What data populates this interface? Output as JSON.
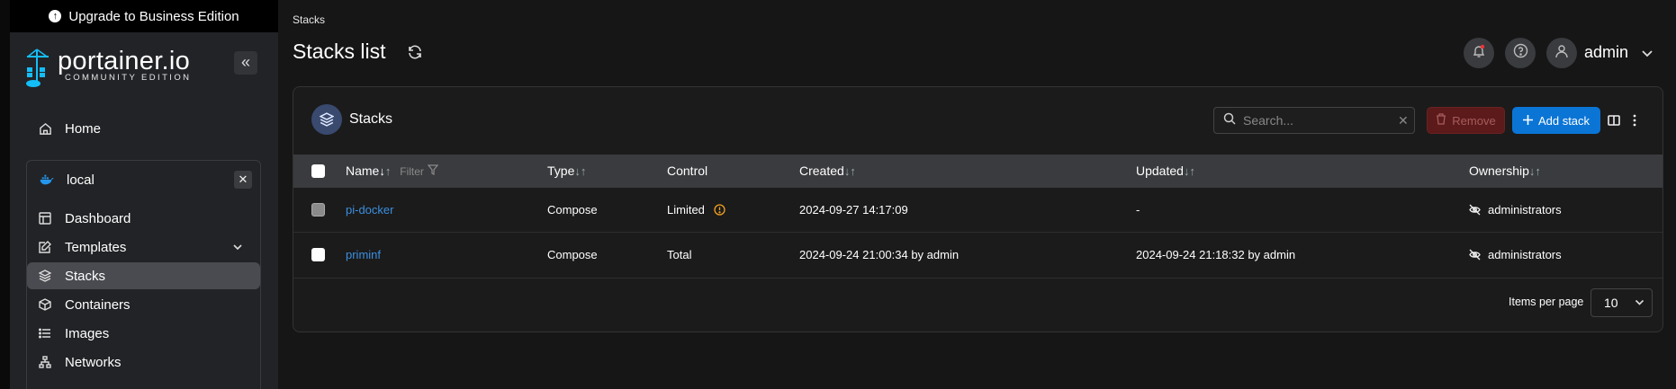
{
  "sidebar": {
    "upgrade_label": "Upgrade to Business Edition",
    "brand": "portainer.io",
    "edition": "COMMUNITY EDITION",
    "home": "Home",
    "environment": "local",
    "items": [
      {
        "label": "Dashboard",
        "icon": "dashboard-icon"
      },
      {
        "label": "Templates",
        "icon": "edit-icon"
      },
      {
        "label": "Stacks",
        "icon": "layers-icon"
      },
      {
        "label": "Containers",
        "icon": "box-icon"
      },
      {
        "label": "Images",
        "icon": "list-icon"
      },
      {
        "label": "Networks",
        "icon": "network-icon"
      }
    ]
  },
  "header": {
    "breadcrumb": "Stacks",
    "title": "Stacks list",
    "user": "admin"
  },
  "panel": {
    "title": "Stacks",
    "search_placeholder": "Search...",
    "remove_label": "Remove",
    "add_label": "Add stack"
  },
  "table": {
    "columns": {
      "name": "Name",
      "filter": "Filter",
      "type": "Type",
      "control": "Control",
      "created": "Created",
      "updated": "Updated",
      "ownership": "Ownership"
    },
    "rows": [
      {
        "name": "pi-docker",
        "type": "Compose",
        "control": "Limited",
        "created": "2024-09-27 14:17:09",
        "updated": "-",
        "ownership": "administrators"
      },
      {
        "name": "priminf",
        "type": "Compose",
        "control": "Total",
        "created": "2024-09-24 21:00:34 by admin",
        "updated": "2024-09-24 21:18:32 by admin",
        "ownership": "administrators"
      }
    ]
  },
  "pagination": {
    "items_per_page_label": "Items per page",
    "items_per_page": "10"
  },
  "colors": {
    "accent": "#0b75d6",
    "link": "#3b8fe0",
    "danger_bg": "#5c1a1a",
    "warning": "#f0a020"
  }
}
